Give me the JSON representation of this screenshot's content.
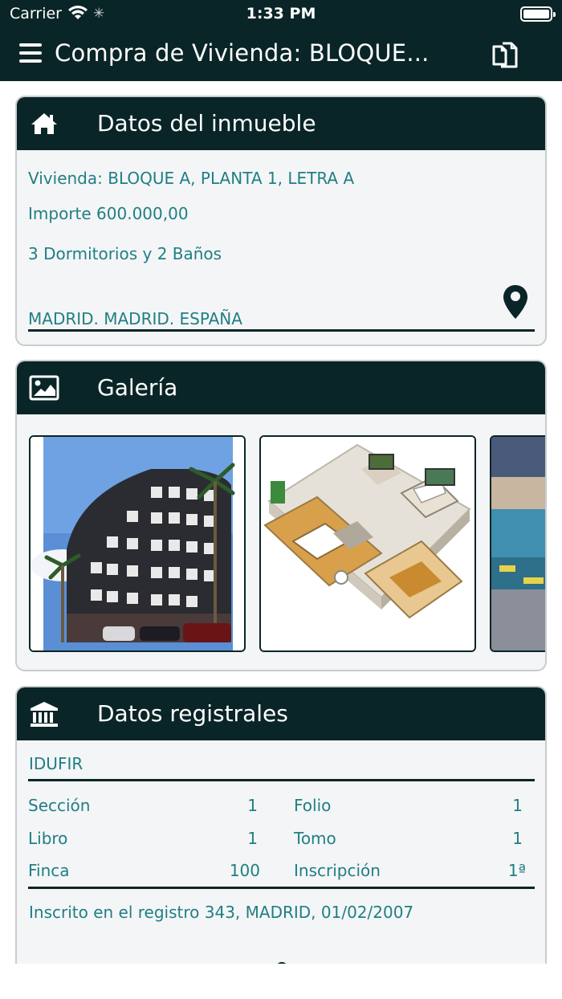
{
  "status_bar": {
    "carrier": "Carrier",
    "time": "1:33 PM"
  },
  "header": {
    "title": "Compra de Vivienda: BLOQUE...",
    "menu_icon": "hamburger-menu-icon",
    "action_icon": "copy-documents-icon",
    "background_color": "#0a2527"
  },
  "property_card": {
    "title": "Datos del inmueble",
    "icon": "home-icon",
    "vivienda": "Vivienda: BLOQUE A, PLANTA 1, LETRA A",
    "importe": "Importe 600.000,00",
    "rooms": "3 Dormitorios y 2 Baños",
    "location": "MADRID. MADRID. ESPAÑA",
    "location_icon": "map-pin-icon"
  },
  "gallery_card": {
    "title": "Galería",
    "icon": "image-icon",
    "images": [
      {
        "name": "building-photo"
      },
      {
        "name": "floorplan-3d-render"
      },
      {
        "name": "partial-photo"
      }
    ]
  },
  "registry_card": {
    "title": "Datos registrales",
    "icon": "bank-building-icon",
    "idufir_label": "IDUFIR",
    "fields": [
      {
        "label": "Sección",
        "value": "1"
      },
      {
        "label": "Folio",
        "value": "1"
      },
      {
        "label": "Libro",
        "value": "1"
      },
      {
        "label": "Tomo",
        "value": "1"
      },
      {
        "label": "Finca",
        "value": "100"
      },
      {
        "label": "Inscripción",
        "value": "1ª"
      }
    ],
    "inscrito": "Inscrito en el registro 343, MADRID, 01/02/2007"
  },
  "colors": {
    "accent_text": "#1f7f83",
    "header_bg": "#0a2527",
    "card_bg": "#f4f5f7"
  }
}
